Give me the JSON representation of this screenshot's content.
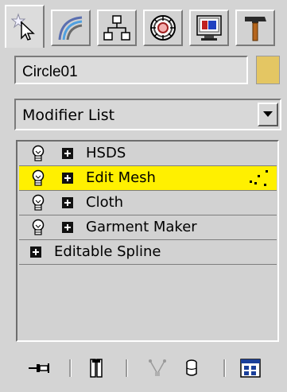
{
  "tabs": [
    {
      "name": "create",
      "icon": "create-star-cursor-icon",
      "active": true
    },
    {
      "name": "modify",
      "icon": "modify-arc-icon",
      "active": false
    },
    {
      "name": "hierarchy",
      "icon": "hierarchy-tree-icon",
      "active": false
    },
    {
      "name": "motion",
      "icon": "motion-wheel-icon",
      "active": false
    },
    {
      "name": "display",
      "icon": "display-monitor-icon",
      "active": false
    },
    {
      "name": "utilities",
      "icon": "utilities-hammer-icon",
      "active": false
    }
  ],
  "object": {
    "name": "Circle01",
    "color": "#e4c663"
  },
  "modifier_list": {
    "selected": "Modifier List"
  },
  "stack": {
    "items": [
      {
        "label": "HSDS",
        "has_bulb": true,
        "selected": false
      },
      {
        "label": "Edit Mesh",
        "has_bulb": true,
        "selected": true
      },
      {
        "label": "Cloth",
        "has_bulb": true,
        "selected": false
      },
      {
        "label": "Garment Maker",
        "has_bulb": true,
        "selected": false
      },
      {
        "label": "Editable Spline",
        "has_bulb": false,
        "selected": false
      }
    ]
  },
  "toolbar": {
    "buttons": [
      {
        "name": "pin-stack",
        "icon": "pin-icon"
      },
      {
        "name": "show-end-result",
        "icon": "end-result-icon"
      },
      {
        "name": "make-unique",
        "icon": "make-unique-icon"
      },
      {
        "name": "remove-modifier",
        "icon": "trash-can-icon"
      },
      {
        "name": "configure-modifier-sets",
        "icon": "configure-sets-icon"
      }
    ]
  },
  "colors": {
    "panel_bg": "#d4d4d4",
    "selection": "#fff000"
  }
}
